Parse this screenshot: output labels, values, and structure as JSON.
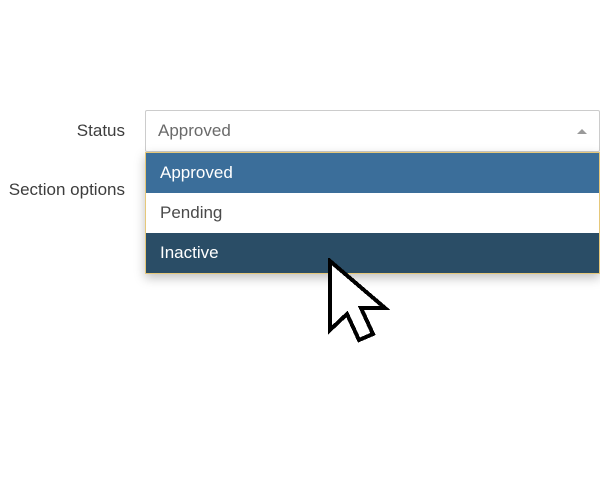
{
  "form": {
    "status_label": "Status",
    "section_options_label": "Section options"
  },
  "status_select": {
    "value": "Approved",
    "options": [
      {
        "label": "Approved",
        "state": "selected"
      },
      {
        "label": "Pending",
        "state": "normal"
      },
      {
        "label": "Inactive",
        "state": "hovered"
      }
    ]
  },
  "colors": {
    "option_selected_bg": "#3b6e9a",
    "option_hover_bg": "#2a4d66"
  }
}
